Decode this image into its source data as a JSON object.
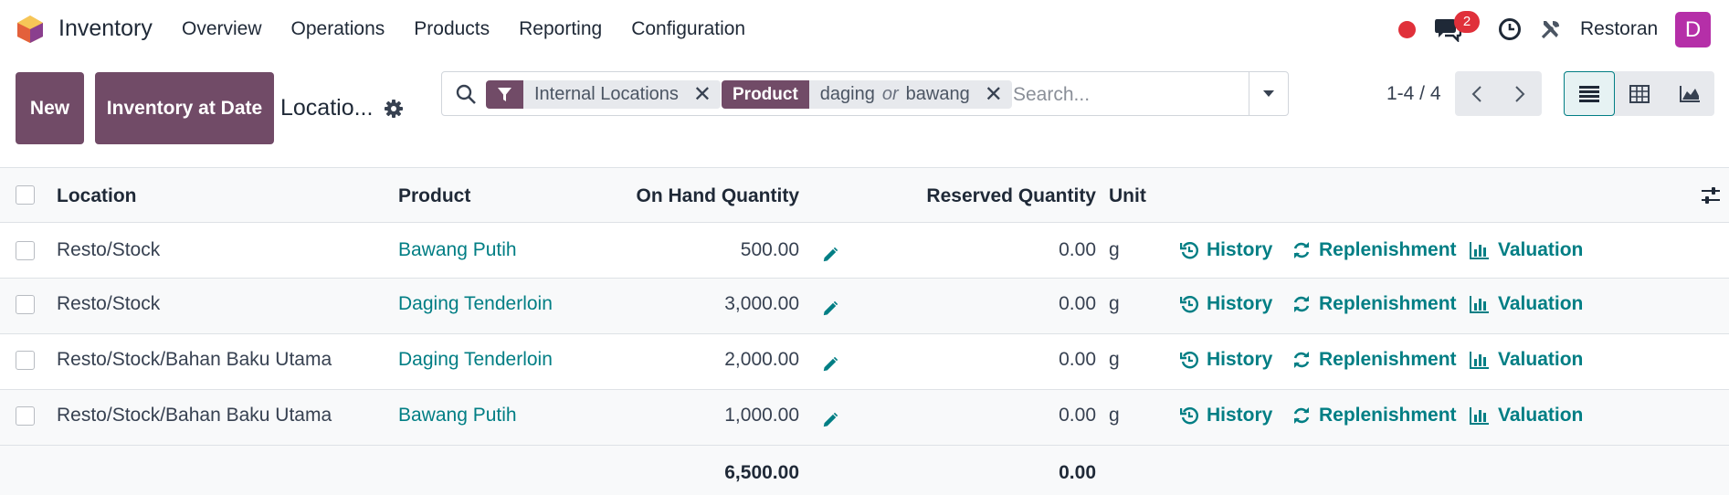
{
  "navbar": {
    "app_name": "Inventory",
    "menu": [
      "Overview",
      "Operations",
      "Products",
      "Reporting",
      "Configuration"
    ],
    "chat_count": "2",
    "company": "Restoran",
    "avatar_letter": "D"
  },
  "control_panel": {
    "new_label": "New",
    "inventory_at_date_label": "Inventory at Date",
    "breadcrumb": "Locatio...",
    "search": {
      "facet_filter_value": "Internal Locations",
      "facet_product_label": "Product",
      "facet_product_value_1": "daging",
      "facet_product_or": "or",
      "facet_product_value_2": "bawang",
      "placeholder": "Search..."
    },
    "pager": "1-4 / 4"
  },
  "table": {
    "columns": {
      "location": "Location",
      "product": "Product",
      "on_hand": "On Hand Quantity",
      "reserved": "Reserved Quantity",
      "unit": "Unit"
    },
    "rows": [
      {
        "location": "Resto/Stock",
        "product": "Bawang Putih",
        "on_hand": "500.00",
        "reserved": "0.00",
        "unit": "g"
      },
      {
        "location": "Resto/Stock",
        "product": "Daging Tenderloin",
        "on_hand": "3,000.00",
        "reserved": "0.00",
        "unit": "g"
      },
      {
        "location": "Resto/Stock/Bahan Baku Utama",
        "product": "Daging Tenderloin",
        "on_hand": "2,000.00",
        "reserved": "0.00",
        "unit": "g"
      },
      {
        "location": "Resto/Stock/Bahan Baku Utama",
        "product": "Bawang Putih",
        "on_hand": "1,000.00",
        "reserved": "0.00",
        "unit": "g"
      }
    ],
    "actions": {
      "history": "History",
      "replenishment": "Replenishment",
      "valuation": "Valuation"
    },
    "totals": {
      "on_hand": "6,500.00",
      "reserved": "0.00"
    }
  },
  "colors": {
    "brand": "#714b67",
    "link": "#017e84",
    "badge": "#e0303a",
    "avatar": "#b52fa8"
  }
}
